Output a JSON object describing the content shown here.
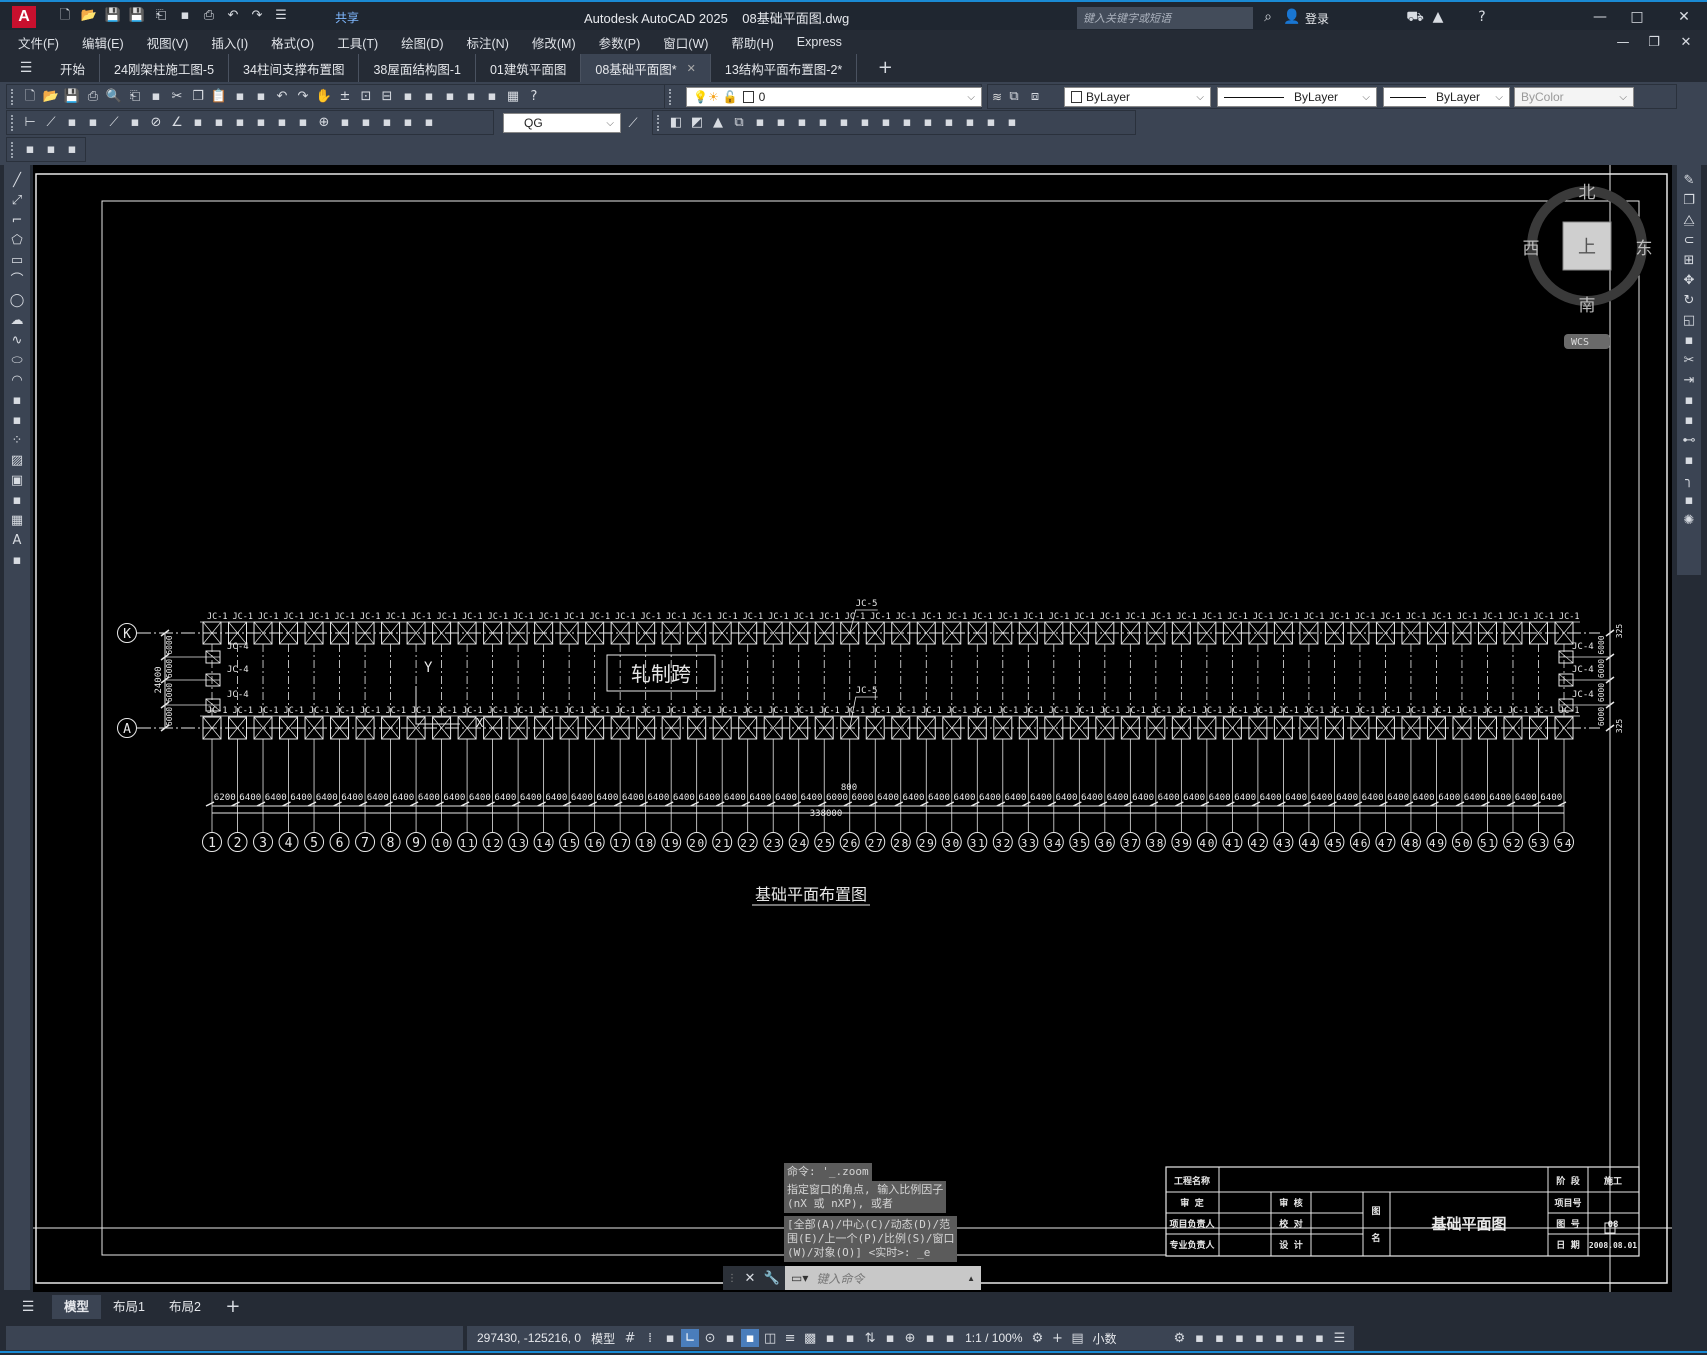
{
  "app": {
    "title": "Autodesk AutoCAD 2025",
    "file": "08基础平面图.dwg",
    "logo": "A",
    "share": "共享",
    "search_placeholder": "键入关键字或短语",
    "login": "登录"
  },
  "quick_access_icons": [
    "new",
    "open",
    "save",
    "save-as",
    "publish",
    "share-app",
    "plot",
    "undo",
    "redo",
    "customize"
  ],
  "menu": [
    "文件(F)",
    "编辑(E)",
    "视图(V)",
    "插入(I)",
    "格式(O)",
    "工具(T)",
    "绘图(D)",
    "标注(N)",
    "修改(M)",
    "参数(P)",
    "窗口(W)",
    "帮助(H)",
    "Express"
  ],
  "file_tabs": [
    {
      "label": "开始",
      "active": false
    },
    {
      "label": "24刚架柱施工图-5",
      "active": false
    },
    {
      "label": "34柱间支撑布置图",
      "active": false
    },
    {
      "label": "38屋面结构图-1",
      "active": false
    },
    {
      "label": "01建筑平面图",
      "active": false
    },
    {
      "label": "08基础平面图*",
      "active": true
    },
    {
      "label": "13结构平面布置图-2*",
      "active": false
    }
  ],
  "toolbar_row1_icons": [
    "new",
    "open",
    "save",
    "plot",
    "plot-preview",
    "publish",
    "dwf",
    "cut",
    "copy",
    "paste",
    "match-properties",
    "block-editor",
    "undo",
    "redo",
    "pan",
    "zoom-realtime",
    "zoom-window",
    "zoom-previous",
    "properties",
    "design-center",
    "tool-palettes",
    "sheet-set",
    "markup",
    "calculator",
    "help"
  ],
  "layer": {
    "current": "0",
    "color": "ByLayer",
    "linetype": "ByLayer",
    "lineweight": "ByLayer",
    "plotstyle": "ByColor"
  },
  "toolbar_row2_icons": [
    "linear-dim",
    "aligned-dim",
    "arc-length",
    "ordinate-dim",
    "radius-dim",
    "jogged-dim",
    "diameter-dim",
    "angular-dim",
    "quick-dim",
    "baseline-dim",
    "continue-dim",
    "space-dim",
    "break-dim",
    "tolerance",
    "center-mark",
    "inspection",
    "jogged-linear",
    "dim-edit",
    "dim-text-edit",
    "dim-update"
  ],
  "dim_style": "QG",
  "toolbar_row2b_icons": [
    "box",
    "wedge",
    "cone",
    "union",
    "subtract",
    "intersect",
    "extrude",
    "revolve",
    "slice",
    "interfere",
    "section",
    "flatten",
    "imprint",
    "separate",
    "clean",
    "shell",
    "check"
  ],
  "toolbar_row3_icons": [
    "block-edit",
    "attribute-edit",
    "layer-walk"
  ],
  "left_tools": [
    "line",
    "construction-line",
    "polyline",
    "polygon",
    "rectangle",
    "arc",
    "circle",
    "revision-cloud",
    "spline",
    "ellipse",
    "ellipse-arc",
    "insert-block",
    "make-block",
    "point",
    "hatch",
    "gradient",
    "region",
    "table",
    "multiline-text",
    "add-selected"
  ],
  "right_tools": [
    "erase",
    "copy",
    "mirror",
    "offset",
    "array",
    "move",
    "rotate",
    "scale",
    "stretch",
    "trim",
    "extend",
    "break-at-point",
    "break",
    "join",
    "chamfer",
    "fillet",
    "blend",
    "explode"
  ],
  "viewcube": {
    "north": "北",
    "south": "南",
    "west": "西",
    "east": "东",
    "top": "上",
    "wcs": "WCS"
  },
  "drawing": {
    "rows": [
      "K",
      "A"
    ],
    "axes": [
      "1",
      "2",
      "3",
      "4",
      "5",
      "6",
      "7",
      "8",
      "9",
      "10",
      "11",
      "12",
      "13",
      "14",
      "15",
      "16",
      "17",
      "18",
      "19",
      "20",
      "21",
      "22",
      "23",
      "24",
      "25",
      "26",
      "27",
      "28",
      "29",
      "30",
      "31",
      "32",
      "33",
      "34",
      "35",
      "36",
      "37",
      "38",
      "39",
      "40",
      "41",
      "42",
      "43",
      "44",
      "45",
      "46",
      "47",
      "48",
      "49",
      "50",
      "51",
      "52",
      "53",
      "54"
    ],
    "spans": [
      "6200",
      "6400",
      "6400",
      "6400",
      "6400",
      "6400",
      "6400",
      "6400",
      "6400",
      "6400",
      "6400",
      "6400",
      "6400",
      "6400",
      "6400",
      "6400",
      "6400",
      "6400",
      "6400",
      "6400",
      "6400",
      "6400",
      "6400",
      "6400",
      "6000",
      "6000",
      "6400",
      "6400",
      "6400",
      "6400",
      "6400",
      "6400",
      "6400",
      "6400",
      "6400",
      "6400",
      "6400",
      "6400",
      "6400",
      "6400",
      "6400",
      "6400",
      "6400",
      "6400",
      "6400",
      "6400",
      "6400",
      "6400",
      "6400",
      "6400",
      "6400",
      "6400",
      "6400"
    ],
    "total_length": "338000",
    "offset": "800",
    "column_footing": "JC-1",
    "gable_footing": "JC-4",
    "special_footing": "JC-5",
    "bay_width_total": "24000",
    "bay_segments": [
      "6000",
      "6000",
      "6000",
      "6000"
    ],
    "edge_offset": "325",
    "area_label": "轧制跨",
    "ucs_x": "X",
    "ucs_y": "Y",
    "drawing_title": "基础平面布置图"
  },
  "title_block": {
    "project_label": "工程名称",
    "stage_label": "阶 段",
    "stage": "施工",
    "approve": "审 定",
    "review": "审 核",
    "pm": "项目负责人",
    "check": "校 对",
    "lead": "专业负责人",
    "design": "设 计",
    "name_label_1": "图",
    "name_label_2": "名",
    "drawing_name": "基础平面图",
    "project_no_label": "项目号",
    "sheet_no_label": "图 号",
    "sheet_no": "08",
    "date_label": "日 期",
    "date": "2008.08.01"
  },
  "command": {
    "history": [
      "命令: '_.zoom",
      "指定窗口的角点, 输入比例因子\n(nX 或 nXP), 或者",
      "[全部(A)/中心(C)/动态(D)/范\n围(E)/上一个(P)/比例(S)/窗口\n(W)/对象(O)] <实时>: _e"
    ],
    "placeholder": "键入命令"
  },
  "layout_tabs": [
    {
      "label": "模型",
      "active": true
    },
    {
      "label": "布局1",
      "active": false
    },
    {
      "label": "布局2",
      "active": false
    }
  ],
  "status": {
    "coords": "297430, -125216, 0",
    "space": "模型",
    "scale": "1:1 / 100%",
    "units": "小数"
  },
  "status_icons_a": [
    "grid",
    "snap-mode",
    "infer-constraints",
    "ortho",
    "polar",
    "isodraft",
    "object-snap-tracking",
    "object-snap",
    "lineweight",
    "transparency",
    "selection-cycling",
    "3d-osnap"
  ],
  "status_icons_b": [
    "dynamic-ucs",
    "selection-filter",
    "gizmo",
    "annotation-visibility",
    "auto-scale"
  ],
  "status_icons_c": [
    "workspace",
    "annotation-monitor",
    "units",
    "quick-properties",
    "lock-ui",
    "isolate",
    "hardware-accel",
    "clean-screen",
    "customize"
  ]
}
